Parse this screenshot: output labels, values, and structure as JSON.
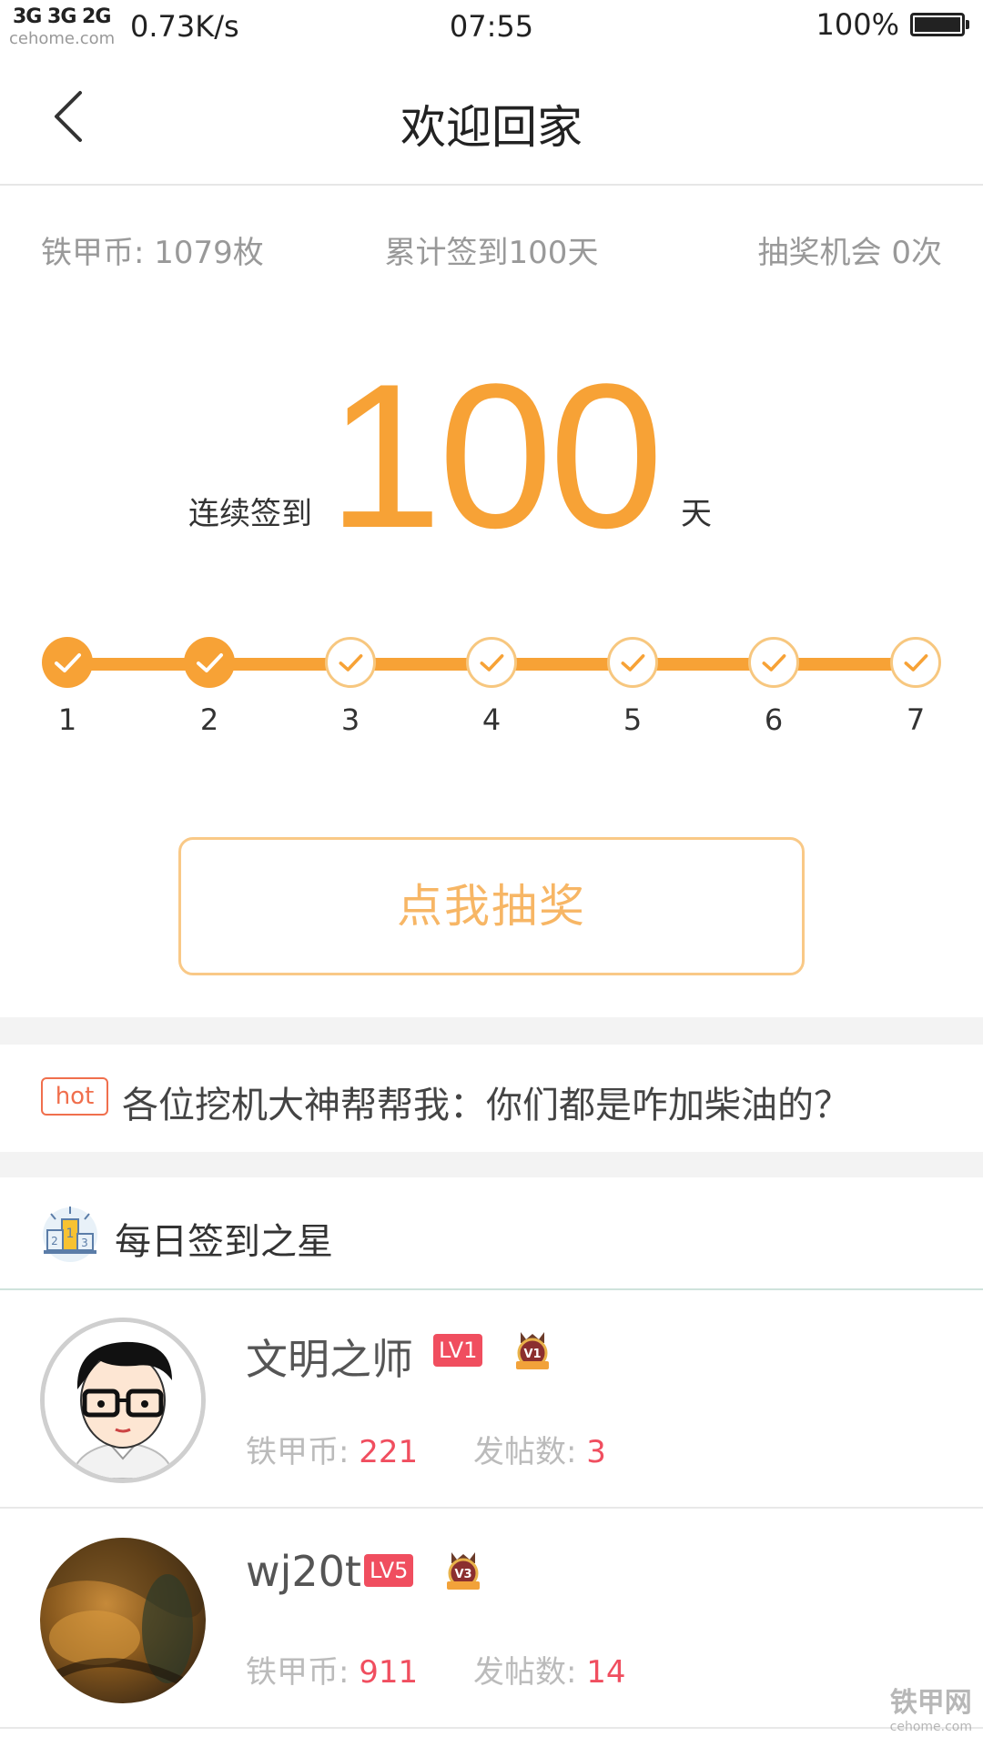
{
  "status_bar": {
    "signal": "3G 3G 2G",
    "speed": "0.73K/s",
    "time": "07:55",
    "battery": "100%",
    "watermark": "cehome.com"
  },
  "header": {
    "title": "欢迎回家"
  },
  "stats": {
    "coins": "铁甲币: 1079枚",
    "total_checkins": "累计签到100天",
    "draw_chances": "抽奖机会 0次"
  },
  "streak": {
    "label": "连续签到",
    "number": "100",
    "unit": "天"
  },
  "progress": {
    "days": [
      {
        "num": "1",
        "done": true
      },
      {
        "num": "2",
        "done": true
      },
      {
        "num": "3",
        "done": false
      },
      {
        "num": "4",
        "done": false
      },
      {
        "num": "5",
        "done": false
      },
      {
        "num": "6",
        "done": false
      },
      {
        "num": "7",
        "done": false
      }
    ]
  },
  "draw_button": {
    "label": "点我抽奖"
  },
  "news": {
    "badge": "hot",
    "text": "各位挖机大神帮帮我：你们都是咋加柴油的？"
  },
  "stars": {
    "title": "每日签到之星",
    "users": [
      {
        "name": "文明之师",
        "level": "LV1",
        "vip": "V1",
        "coins_label": "铁甲币: ",
        "coins": "221",
        "posts_label": "发帖数: ",
        "posts": "3"
      },
      {
        "name": "wj20t",
        "level": "LV5",
        "vip": "V3",
        "coins_label": "铁甲币: ",
        "coins": "911",
        "posts_label": "发帖数: ",
        "posts": "14"
      }
    ]
  },
  "watermark": {
    "brand": "铁甲网",
    "site": "cehome.com"
  },
  "colors": {
    "accent": "#f7a236",
    "badge_red": "#f04e5f",
    "hot": "#f06f4d"
  }
}
